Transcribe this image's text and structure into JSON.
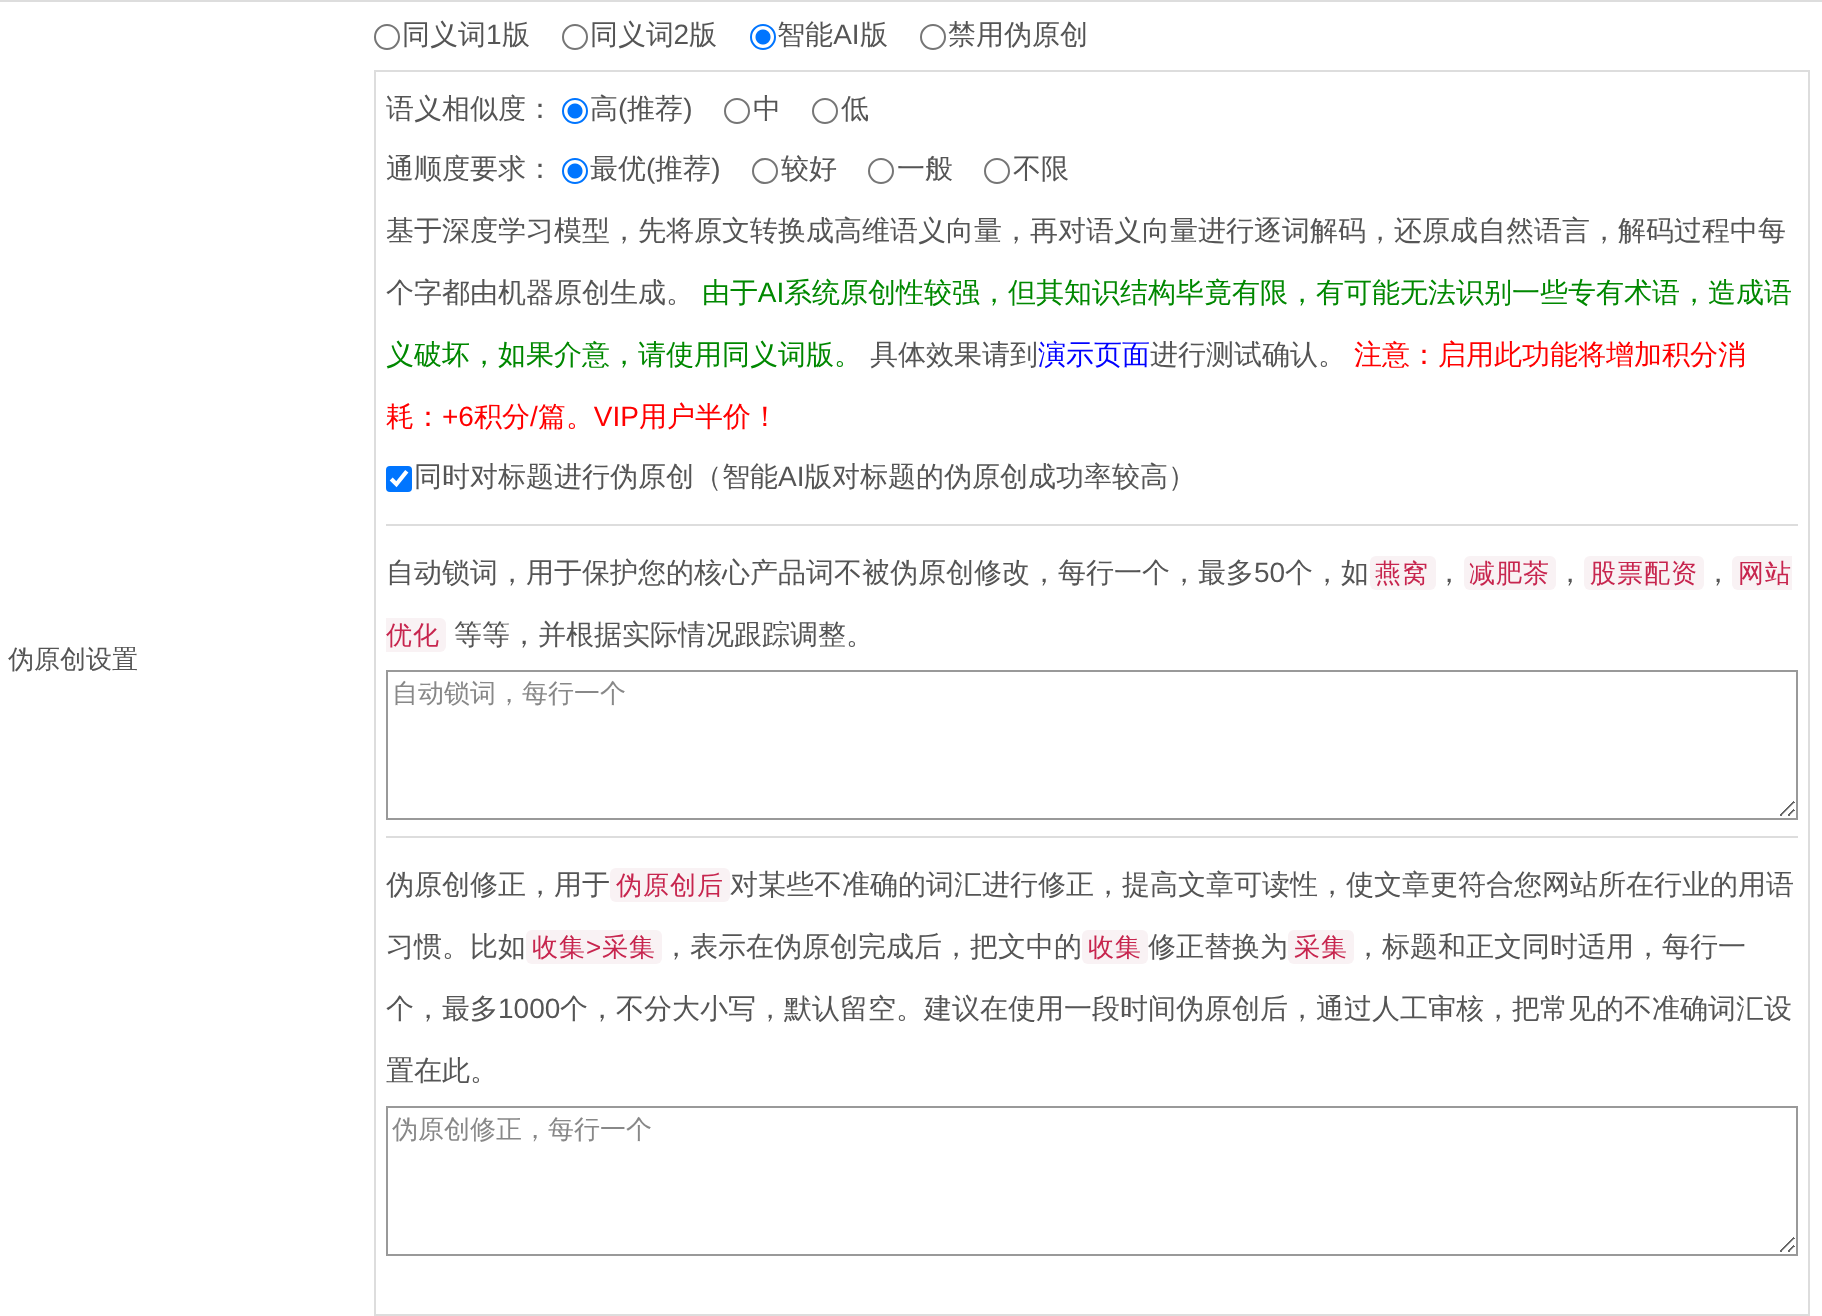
{
  "side_label": "伪原创设置",
  "modes": [
    {
      "label": "同义词1版",
      "selected": false
    },
    {
      "label": "同义词2版",
      "selected": false
    },
    {
      "label": "智能AI版",
      "selected": true
    },
    {
      "label": "禁用伪原创",
      "selected": false
    }
  ],
  "similarity": {
    "label": "语义相似度：",
    "options": [
      {
        "label": "高(推荐)",
        "selected": true
      },
      {
        "label": "中",
        "selected": false
      },
      {
        "label": "低",
        "selected": false
      }
    ]
  },
  "fluency": {
    "label": "通顺度要求：",
    "options": [
      {
        "label": "最优(推荐)",
        "selected": true
      },
      {
        "label": "较好",
        "selected": false
      },
      {
        "label": "一般",
        "selected": false
      },
      {
        "label": "不限",
        "selected": false
      }
    ]
  },
  "description": [
    {
      "kind": "plain",
      "text": "基于深度学习模型，先将原文转换成高维语义向量，再对语义向量进行逐词解码，还原成自然语言，解码过程中每个字都由机器原创生成。 "
    },
    {
      "kind": "green",
      "text": "由于AI系统原创性较强，但其知识结构毕竟有限，有可能无法识别一些专有术语，造成语义破坏，如果介意，请使用同义词版。"
    },
    {
      "kind": "plain",
      "text": " 具体效果请到"
    },
    {
      "kind": "link",
      "text": "演示页面"
    },
    {
      "kind": "plain",
      "text": "进行测试确认。 "
    },
    {
      "kind": "red",
      "text": "注意：启用此功能将增加积分消耗：+6积分/篇。VIP用户半价！"
    }
  ],
  "title_option": {
    "label": "同时对标题进行伪原创（智能AI版对标题的伪原创成功率较高）",
    "checked": true
  },
  "lock_words": {
    "description": [
      {
        "kind": "plain",
        "text": "自动锁词，用于保护您的核心产品词不被伪原创修改，每行一个，最多50个，如"
      },
      {
        "kind": "code",
        "text": "燕窝"
      },
      {
        "kind": "plain",
        "text": "，"
      },
      {
        "kind": "code",
        "text": "减肥茶"
      },
      {
        "kind": "plain",
        "text": "，"
      },
      {
        "kind": "code",
        "text": "股票配资"
      },
      {
        "kind": "plain",
        "text": "，"
      },
      {
        "kind": "code",
        "text": "网站优化"
      },
      {
        "kind": "plain",
        "text": " 等等，并根据实际情况跟踪调整。"
      }
    ],
    "placeholder": "自动锁词，每行一个"
  },
  "correction": {
    "description": [
      {
        "kind": "plain",
        "text": "伪原创修正，用于"
      },
      {
        "kind": "code",
        "text": "伪原创后"
      },
      {
        "kind": "plain",
        "text": "对某些不准确的词汇进行修正，提高文章可读性，使文章更符合您网站所在行业的用语习惯。比如"
      },
      {
        "kind": "code",
        "text": "收集>采集"
      },
      {
        "kind": "plain",
        "text": "，表示在伪原创完成后，把文中的"
      },
      {
        "kind": "code",
        "text": "收集"
      },
      {
        "kind": "plain",
        "text": "修正替换为"
      },
      {
        "kind": "code",
        "text": "采集"
      },
      {
        "kind": "plain",
        "text": "，标题和正文同时适用，每行一个，最多1000个，不分大小写，默认留空。建议在使用一段时间伪原创后，通过人工审核，把常见的不准确词汇设置在此。"
      }
    ],
    "placeholder": "伪原创修正，每行一个"
  }
}
